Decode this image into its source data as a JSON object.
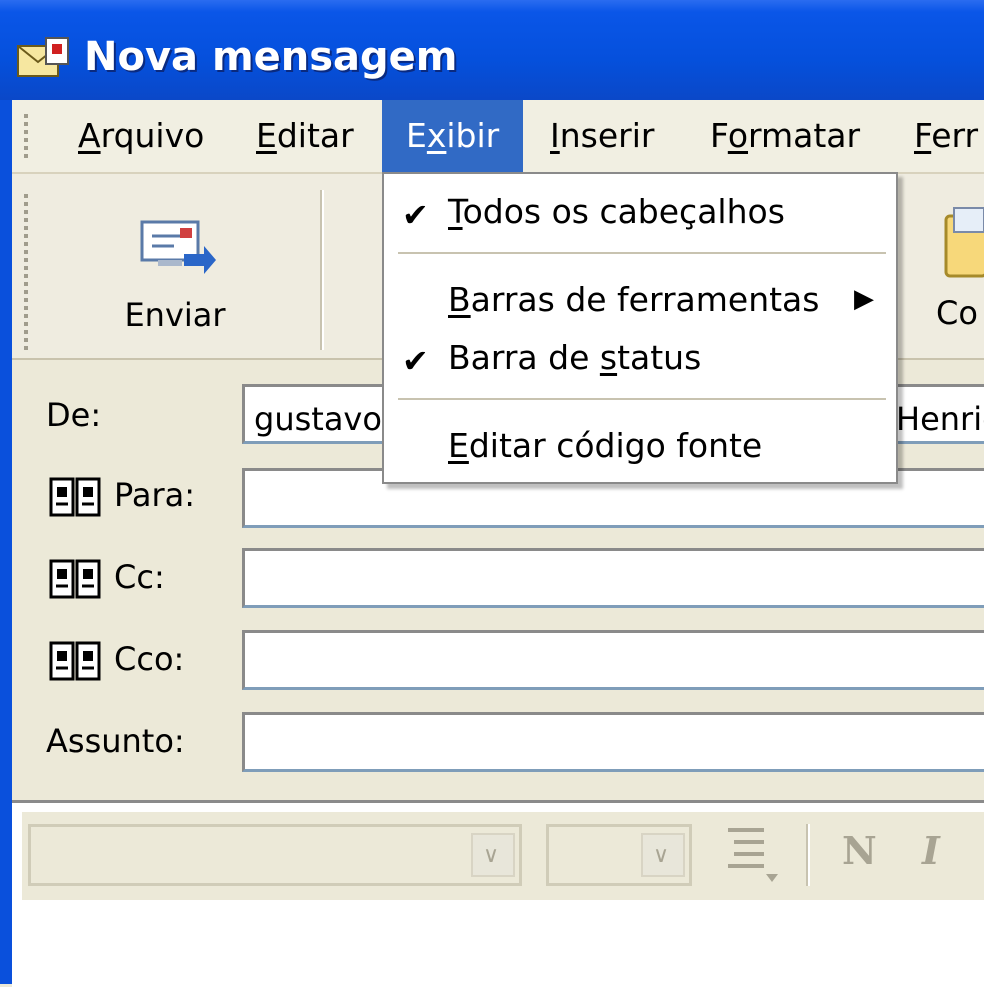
{
  "window": {
    "title": "Nova mensagem"
  },
  "menu": [
    {
      "pre": "",
      "key": "A",
      "post": "rquivo"
    },
    {
      "pre": "",
      "key": "E",
      "post": "ditar"
    },
    {
      "pre": "E",
      "key": "x",
      "post": "ibir"
    },
    {
      "pre": "",
      "key": "I",
      "post": "nserir"
    },
    {
      "pre": "F",
      "key": "o",
      "post": "rmatar"
    },
    {
      "pre": "",
      "key": "F",
      "post": "err"
    }
  ],
  "toolbar": {
    "send_label": "Enviar",
    "partial_label": "Co"
  },
  "dropdown": {
    "items": [
      {
        "pre": "",
        "key": "T",
        "post": "odos os cabeçalhos",
        "checked": "✔"
      },
      {
        "pre": "",
        "key": "B",
        "post": "arras de ferramentas",
        "submenu": "▶"
      },
      {
        "pre": "Barra de ",
        "key": "s",
        "post": "tatus",
        "checked": "✔"
      },
      {
        "pre": "",
        "key": "E",
        "post": "ditar código fonte"
      }
    ]
  },
  "header": {
    "from_label": "De:",
    "from_value": "gustavo",
    "from_value_right": "Henriq",
    "to_label": "Para:",
    "cc_label": "Cc:",
    "bcc_label": "Cco:",
    "subject_label": "Assunto:"
  },
  "format_bar": {
    "bold_label": "N",
    "italic_label": "I"
  }
}
